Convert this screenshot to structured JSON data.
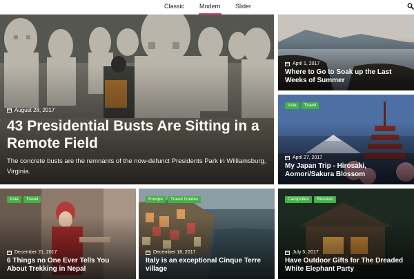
{
  "tabs": [
    {
      "label": "Classic",
      "active": false
    },
    {
      "label": "Modern",
      "active": true
    },
    {
      "label": "Slider",
      "active": false
    }
  ],
  "search": {
    "icon": "search-icon"
  },
  "colors": {
    "accent": "#e0457b",
    "tag_bg": "#43b046",
    "text_on_image": "#ffffff"
  },
  "posts": [
    {
      "date": "August 28, 2017",
      "title": "43 Presidential Busts Are Sitting in a Remote Field",
      "excerpt": "The concrete busts are the remnants of the now-defunct Presidents Park in Williamsburg, Virginia.",
      "tags": []
    },
    {
      "date": "April 1, 2017",
      "title": "Where to Go to Soak up the Last Weeks of Summer",
      "tags": []
    },
    {
      "date": "April 27, 2017",
      "title": "My Japan Trip - Hirosaki, Aomori/Sakura Blossom",
      "tags": [
        "Asia",
        "Travel"
      ]
    },
    {
      "date": "December 21, 2017",
      "title": "6 Things no One Ever Tells You About Trekking in Nepal",
      "tags": [
        "Asia",
        "Travel"
      ]
    },
    {
      "date": "December 18, 2017",
      "title": "Italy is an exceptional Cinque Terre village",
      "tags": [
        "Europe",
        "Travel Guides"
      ]
    },
    {
      "date": "July 5, 2017",
      "title": "Have Outdoor Gifts for The Dreaded White Elephant Party",
      "tags": [
        "Campsites",
        "Reviews"
      ]
    }
  ]
}
